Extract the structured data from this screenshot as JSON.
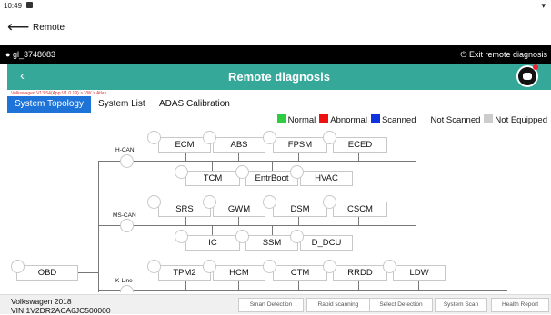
{
  "status": {
    "time": "10:49"
  },
  "app": {
    "title": "Remote"
  },
  "user": {
    "name": "gl_3748083",
    "exit_label": "Exit remote diagnosis"
  },
  "header": {
    "title": "Remote diagnosis"
  },
  "breadcrumb": "Volkswagen V13.54(App:V1.0.19) > VW > Atlas",
  "tabs": [
    "System Topology",
    "System List",
    "ADAS Calibration"
  ],
  "legend": [
    {
      "label": "Normal",
      "color": "#2ecc40"
    },
    {
      "label": "Abnormal",
      "color": "#ee1111"
    },
    {
      "label": "Scanned",
      "color": "#1133dd"
    },
    {
      "label": "Not Scanned",
      "color": "#ffffff"
    },
    {
      "label": "Not Equipped",
      "color": "#cccccc"
    }
  ],
  "topology": {
    "buses": [
      "H-CAN",
      "MS-CAN",
      "K-Line"
    ],
    "root": "OBD",
    "modules": [
      "ECM",
      "ABS",
      "FPSM",
      "ECED",
      "TCM",
      "EntrBoot",
      "HVAC",
      "SRS",
      "GWM",
      "DSM",
      "CSCM",
      "IC",
      "SSM",
      "D_DCU",
      "TPM2",
      "HCM",
      "CTM",
      "RRDD",
      "LDW"
    ]
  },
  "vehicle": {
    "model": "Volkswagen 2018",
    "vin": "VIN 1V2DR2ACA6JC500000"
  },
  "actions": [
    "Smart Detection",
    "Rapid scanning",
    "Select Detection",
    "System Scan",
    "Health Report"
  ]
}
